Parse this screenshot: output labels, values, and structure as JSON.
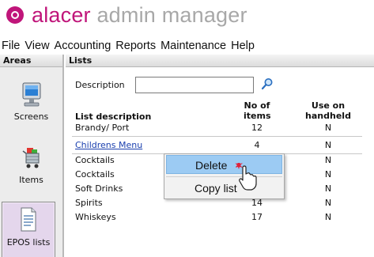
{
  "app": {
    "brand_primary": "alacer",
    "brand_secondary": " admin manager",
    "brand_color": "#c0157a"
  },
  "menubar": {
    "items": [
      "File",
      "View",
      "Accounting",
      "Reports",
      "Maintenance",
      "Help"
    ]
  },
  "areas": {
    "title": "Areas",
    "items": [
      {
        "label": "Screens",
        "icon": "monitor-icon"
      },
      {
        "label": "Items",
        "icon": "shopping-cart-icon"
      },
      {
        "label": "EPOS lists",
        "icon": "document-list-icon",
        "selected": true
      }
    ]
  },
  "lists": {
    "title": "Lists",
    "search": {
      "label": "Description",
      "value": "",
      "icon": "search-icon"
    },
    "columns": {
      "description": "List description",
      "count_line1": "No of",
      "count_line2": "items",
      "handheld_line1": "Use on",
      "handheld_line2": "handheld"
    },
    "rows": [
      {
        "description": "Brandy/ Port",
        "count": "12",
        "handheld": "N"
      },
      {
        "description": "Childrens Menu",
        "count": "4",
        "handheld": "N",
        "link": true
      },
      {
        "description": "Cocktails",
        "count": "",
        "handheld": "N"
      },
      {
        "description": "Cocktails",
        "count": "",
        "handheld": "N"
      },
      {
        "description": "Soft  Drinks",
        "count": "",
        "handheld": "N"
      },
      {
        "description": "Spirits",
        "count": "14",
        "handheld": "N"
      },
      {
        "description": "Whiskeys",
        "count": "17",
        "handheld": "N"
      }
    ]
  },
  "context_menu": {
    "items": [
      "Delete",
      "Copy list"
    ]
  }
}
